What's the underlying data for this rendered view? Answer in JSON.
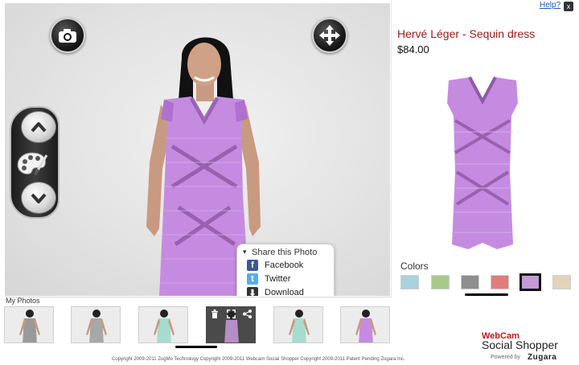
{
  "header": {
    "help_label": "Help?",
    "close_label": "x"
  },
  "product": {
    "title": "Hervé Léger - Sequin dress",
    "price": "$84.00",
    "color": "#c58be0"
  },
  "colors": {
    "label": "Colors",
    "swatches": [
      {
        "name": "light-blue",
        "hex": "#a9d3dc"
      },
      {
        "name": "light-green",
        "hex": "#a9c98a"
      },
      {
        "name": "gray",
        "hex": "#8e8e8e"
      },
      {
        "name": "coral",
        "hex": "#e07c7c"
      },
      {
        "name": "lavender",
        "hex": "#c49ad6",
        "selected": true
      },
      {
        "name": "beige",
        "hex": "#e3d3b8"
      }
    ]
  },
  "controls": {
    "camera_icon": "camera-icon",
    "rotate_icon": "rotate-icon",
    "up_icon": "chevron-up-icon",
    "palette_icon": "palette-icon",
    "down_icon": "chevron-down-icon"
  },
  "share_popup": {
    "title": "Share this Photo",
    "items": [
      {
        "label": "Facebook",
        "icon": "facebook-icon",
        "color": "#3b5998"
      },
      {
        "label": "Twitter",
        "icon": "twitter-icon",
        "color": "#55acee"
      },
      {
        "label": "Download",
        "icon": "download-icon",
        "color": "#333333"
      }
    ]
  },
  "photos": {
    "label": "My Photos",
    "thumbs": [
      {
        "dress": "#9a9a9a"
      },
      {
        "dress": "#a8a8a8"
      },
      {
        "dress": "#a6dccf"
      },
      {
        "dress": "#b58ec8",
        "active": true
      },
      {
        "dress": "#a6dccf"
      },
      {
        "dress": "#c58be0"
      }
    ]
  },
  "branding": {
    "webcam": "WebCam",
    "social_shopper": "Social Shopper",
    "powered_by": "Powered by",
    "zugara": "Zugara"
  },
  "footer": {
    "copyright": "Copyright 2009-2011 ZugMo Technology Copyright 2009-2011 Webcam Social Shopper Copyright 2009-2011 Patent Pending Zugara Inc."
  }
}
